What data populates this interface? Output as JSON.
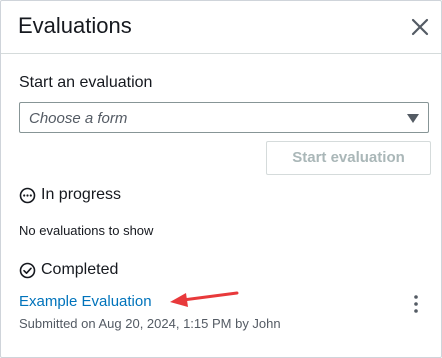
{
  "header": {
    "title": "Evaluations",
    "close_icon": "close-icon"
  },
  "start": {
    "label": "Start an evaluation",
    "form_placeholder": "Choose a form",
    "button_label": "Start evaluation"
  },
  "in_progress": {
    "label": "In progress",
    "icon": "in-progress-icon",
    "empty_message": "No evaluations to show"
  },
  "completed": {
    "label": "Completed",
    "icon": "check-circle-icon",
    "items": [
      {
        "title": "Example Evaluation",
        "submitted": "Submitted on Aug 20, 2024, 1:15 PM by John"
      }
    ]
  },
  "colors": {
    "link": "#0073bb",
    "annotation_arrow": "#e8393b",
    "disabled_text": "#aab7b8"
  }
}
